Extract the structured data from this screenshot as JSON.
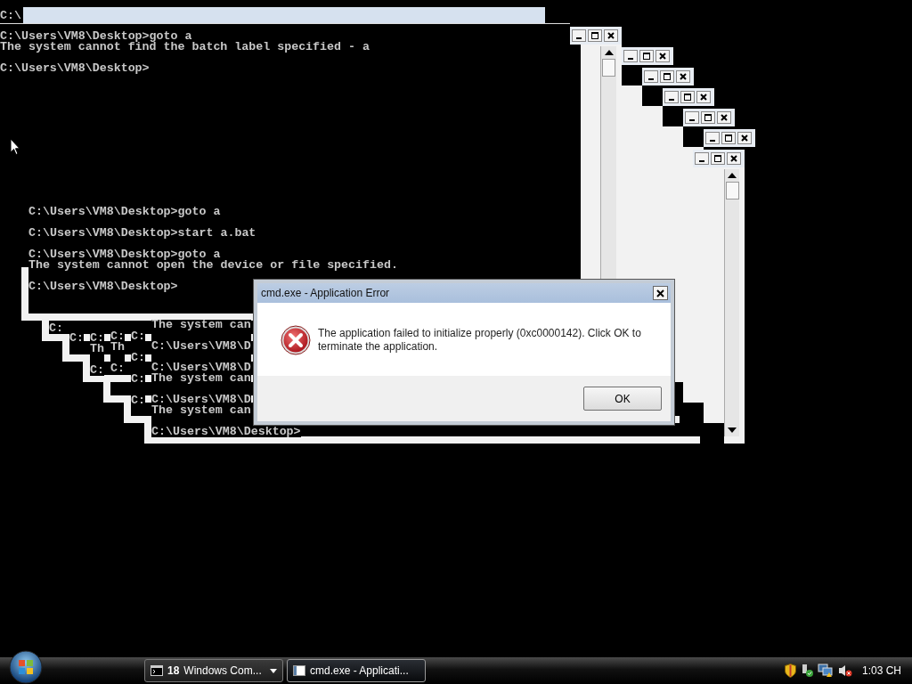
{
  "top_console": {
    "title": "C:\\",
    "lines": [
      {
        "text": "C:\\Users\\VM8\\Desktop>goto a",
        "gap": false
      },
      {
        "text": "The system cannot find the batch label specified - a",
        "gap": false
      },
      {
        "text": "C:\\Users\\VM8\\Desktop>",
        "gap": true
      }
    ]
  },
  "console_windows": [
    {
      "lines": [
        {
          "text": "C:\\Users\\VM8\\Desktop>goto a",
          "gap": false
        },
        {
          "text": "C:\\Users\\VM8\\Desktop>start a.bat",
          "gap": true
        },
        {
          "text": "C:\\Users\\VM8\\Desktop>goto a",
          "gap": true
        },
        {
          "text": "The system cannot open the device or file specified.",
          "gap": false
        },
        {
          "text": "C:\\Users\\VM8\\Desktop>",
          "gap": true
        }
      ]
    },
    {
      "lines": [
        {
          "text": "C:",
          "gap": false
        }
      ]
    },
    {
      "lines": [
        {
          "text": "C:",
          "gap": false
        }
      ]
    },
    {
      "lines": [
        {
          "text": "C:",
          "gap": false
        },
        {
          "text": "Th",
          "gap": false
        },
        {
          "text": "C:",
          "gap": true
        }
      ]
    },
    {
      "lines": [
        {
          "text": "C:",
          "gap": false
        },
        {
          "text": "Th",
          "gap": false
        },
        {
          "text": "C:",
          "gap": true
        }
      ]
    },
    {
      "lines": [
        {
          "text": "C:",
          "gap": false
        },
        {
          "text": "C:",
          "gap": true
        },
        {
          "text": "C:",
          "gap": true
        },
        {
          "text": "C:",
          "gap": true
        }
      ]
    },
    {
      "lines": [
        {
          "text": "The system can",
          "gap": false
        },
        {
          "text": "C:\\Users\\VM8\\D",
          "gap": true
        },
        {
          "text": "C:\\Users\\VM8\\D",
          "gap": true
        },
        {
          "text": "The system can",
          "gap": false
        },
        {
          "text": "C:\\Users\\VM8\\D",
          "gap": true
        },
        {
          "text": "The system can",
          "gap": false
        },
        {
          "text": "C:\\Users\\VM8\\Desktop>",
          "gap": true
        }
      ]
    }
  ],
  "error_dialog": {
    "title": "cmd.exe - Application Error",
    "message": "The application failed to initialize properly (0xc0000142). Click OK to terminate the application.",
    "ok_button": "OK"
  },
  "taskbar": {
    "buttons": [
      {
        "kind": "group",
        "count": "18",
        "label": "Windows Com...",
        "selected": false
      },
      {
        "kind": "window",
        "label": "cmd.exe - Applicati...",
        "selected": true
      }
    ],
    "clock": "1:03 CH"
  }
}
